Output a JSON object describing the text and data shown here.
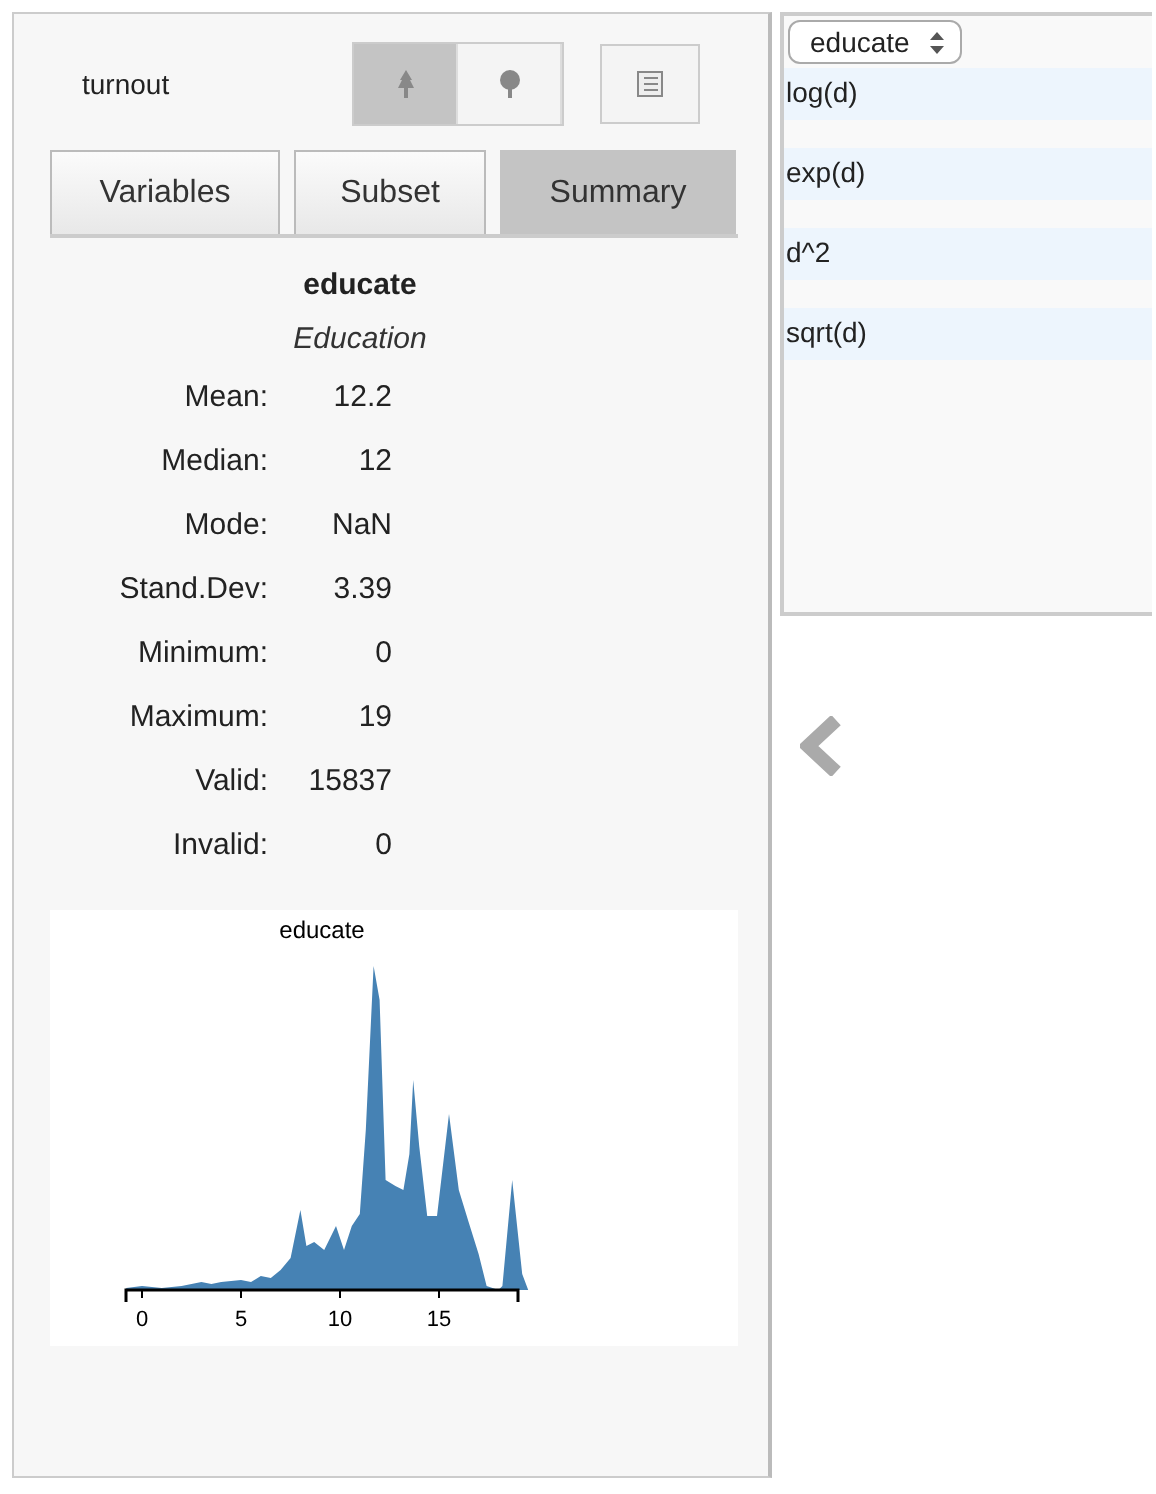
{
  "dataset": {
    "name": "turnout"
  },
  "view_buttons": [
    {
      "kind": "small-tree",
      "selected": true
    },
    {
      "kind": "round-tree",
      "selected": false
    }
  ],
  "tabs": [
    {
      "label": "Variables",
      "selected": false
    },
    {
      "label": "Subset",
      "selected": false
    },
    {
      "label": "Summary",
      "selected": true
    }
  ],
  "variable": {
    "name": "educate",
    "label": "Education"
  },
  "stats": [
    {
      "label": "Mean:",
      "value": "12.2"
    },
    {
      "label": "Median:",
      "value": "12"
    },
    {
      "label": "Mode:",
      "value": "NaN"
    },
    {
      "label": "Stand.Dev:",
      "value": "3.39"
    },
    {
      "label": "Minimum:",
      "value": "0"
    },
    {
      "label": "Maximum:",
      "value": "19"
    },
    {
      "label": "Valid:",
      "value": "15837"
    },
    {
      "label": "Invalid:",
      "value": "0"
    }
  ],
  "plot": {
    "title": "educate",
    "x_tick_labels": [
      "0",
      "5",
      "10",
      "15"
    ]
  },
  "transform": {
    "variable_select": "educate",
    "items": [
      "log(d)",
      "exp(d)",
      "d^2",
      "sqrt(d)"
    ]
  }
}
